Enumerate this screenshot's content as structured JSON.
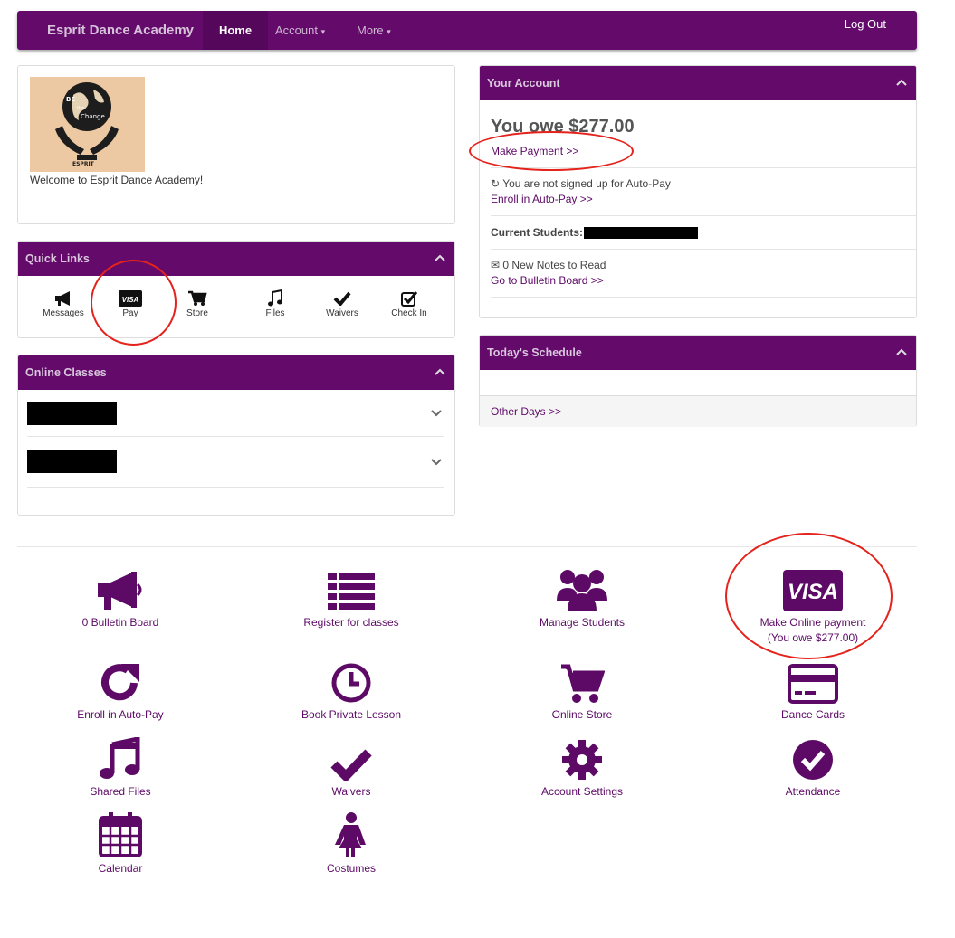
{
  "navbar": {
    "brand": "Esprit Dance Academy",
    "home": "Home",
    "account": "Account",
    "more": "More",
    "logout": "Log Out"
  },
  "welcome": {
    "text": "Welcome to Esprit Dance Academy!"
  },
  "quick_links": {
    "title": "Quick Links",
    "items": [
      {
        "label": "Messages",
        "icon": "megaphone-icon"
      },
      {
        "label": "Pay",
        "icon": "visa-icon"
      },
      {
        "label": "Store",
        "icon": "cart-icon"
      },
      {
        "label": "Files",
        "icon": "music-icon"
      },
      {
        "label": "Waivers",
        "icon": "check-icon"
      },
      {
        "label": "Check In",
        "icon": "checkbox-icon"
      }
    ]
  },
  "online_classes": {
    "title": "Online Classes"
  },
  "account": {
    "title": "Your Account",
    "owe": "You owe $277.00",
    "make_payment": "Make Payment >>",
    "autopay_status": "You are not signed up for Auto-Pay",
    "enroll_autopay": "Enroll in Auto-Pay >>",
    "current_students": "Current Students:",
    "notes": "0 New Notes to Read",
    "bulletin_link": "Go to Bulletin Board >>"
  },
  "schedule": {
    "title": "Today's Schedule",
    "other_days": "Other Days >>"
  },
  "grid": {
    "bulletin": "0 Bulletin Board",
    "register": "Register for classes",
    "students": "Manage Students",
    "pay_line1": "Make Online payment",
    "pay_line2": "(You owe $277.00)",
    "autopay": "Enroll in Auto-Pay",
    "private": "Book Private Lesson",
    "store": "Online Store",
    "dancecards": "Dance Cards",
    "files": "Shared Files",
    "waivers": "Waivers",
    "settings": "Account Settings",
    "attendance": "Attendance",
    "calendar": "Calendar",
    "costumes": "Costumes"
  },
  "logo_text": {
    "be": "BE",
    "the": "the",
    "change": "Change",
    "esprit": "ESPRIT"
  },
  "colors": {
    "brand": "#630a6b",
    "link": "#5d0a66",
    "annotation": "#e3231c"
  }
}
